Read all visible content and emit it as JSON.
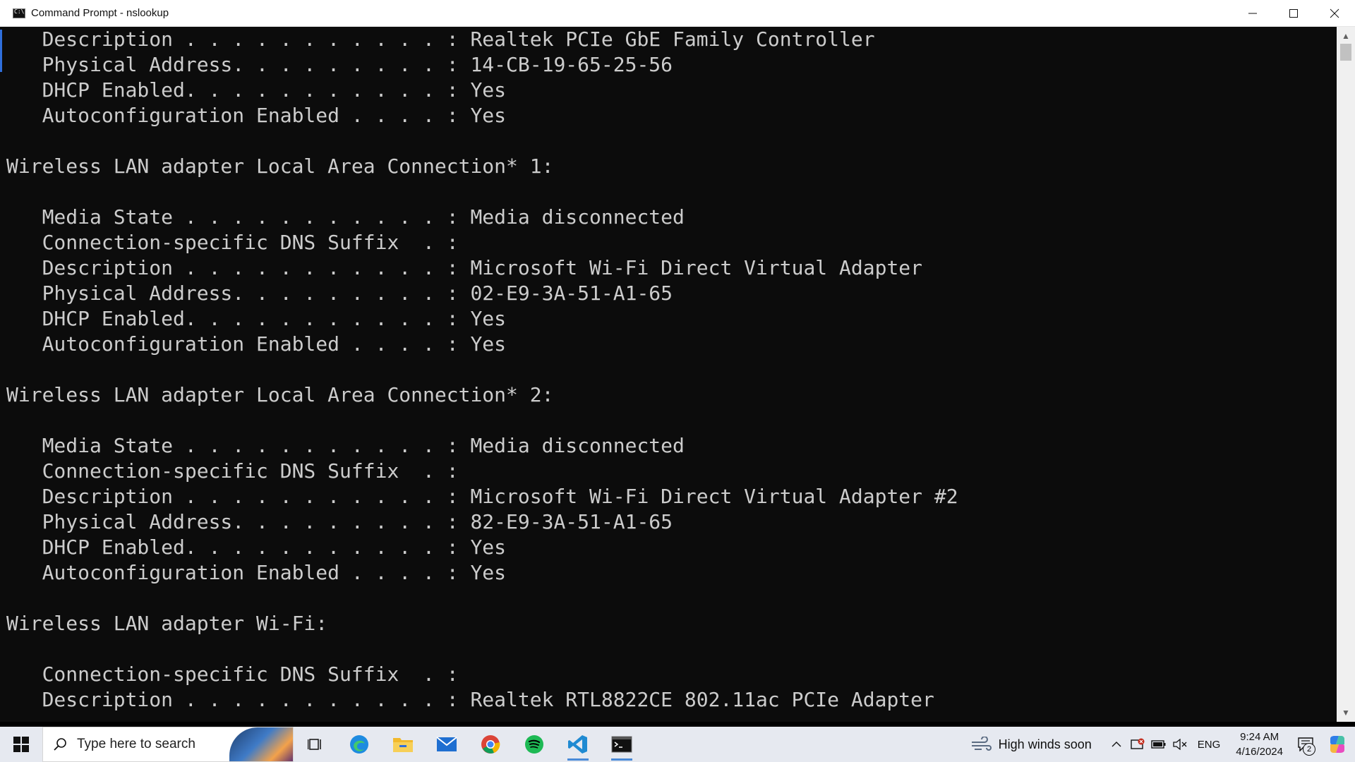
{
  "window": {
    "title": "Command Prompt - nslookup",
    "icon": "cmd-icon",
    "controls": [
      "minimize-icon",
      "maximize-icon",
      "close-icon"
    ]
  },
  "console": {
    "lines": [
      "   Description . . . . . . . . . . . : Realtek PCIe GbE Family Controller",
      "   Physical Address. . . . . . . . . : 14-CB-19-65-25-56",
      "   DHCP Enabled. . . . . . . . . . . : Yes",
      "   Autoconfiguration Enabled . . . . : Yes",
      "",
      "Wireless LAN adapter Local Area Connection* 1:",
      "",
      "   Media State . . . . . . . . . . . : Media disconnected",
      "   Connection-specific DNS Suffix  . :",
      "   Description . . . . . . . . . . . : Microsoft Wi-Fi Direct Virtual Adapter",
      "   Physical Address. . . . . . . . . : 02-E9-3A-51-A1-65",
      "   DHCP Enabled. . . . . . . . . . . : Yes",
      "   Autoconfiguration Enabled . . . . : Yes",
      "",
      "Wireless LAN adapter Local Area Connection* 2:",
      "",
      "   Media State . . . . . . . . . . . : Media disconnected",
      "   Connection-specific DNS Suffix  . :",
      "   Description . . . . . . . . . . . : Microsoft Wi-Fi Direct Virtual Adapter #2",
      "   Physical Address. . . . . . . . . : 82-E9-3A-51-A1-65",
      "   DHCP Enabled. . . . . . . . . . . : Yes",
      "   Autoconfiguration Enabled . . . . : Yes",
      "",
      "Wireless LAN adapter Wi-Fi:",
      "",
      "   Connection-specific DNS Suffix  . :",
      "   Description . . . . . . . . . . . : Realtek RTL8822CE 802.11ac PCIe Adapter"
    ]
  },
  "taskbar": {
    "search_placeholder": "Type here to search",
    "apps": [
      "task-view-icon",
      "edge-icon",
      "file-explorer-icon",
      "mail-icon",
      "chrome-icon",
      "spotify-icon",
      "vscode-icon",
      "terminal-icon"
    ],
    "weather_text": "High winds soon",
    "language": "ENG",
    "time": "9:24 AM",
    "date": "4/16/2024",
    "notification_count": "2"
  },
  "colors": {
    "console_bg": "#0c0c0c",
    "console_text": "#cccccc",
    "taskbar_bg": "#e6e9f0",
    "accent": "#2f6fdc"
  }
}
